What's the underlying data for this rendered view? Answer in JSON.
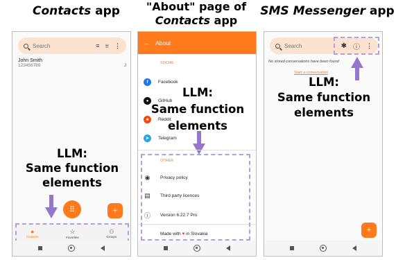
{
  "captions": {
    "left_app": "Contacts",
    "left_suffix": " app",
    "middle_line1": "\"About\" page of",
    "middle_app": "Contacts",
    "middle_suffix": " app",
    "right_app": "SMS Messenger",
    "right_suffix": " app"
  },
  "contacts": {
    "search_placeholder": "Search",
    "contact_name": "John Smith",
    "contact_number": "123456789",
    "contact_initial": "J",
    "tabs": [
      {
        "label": "Contacts",
        "icon": "person-icon"
      },
      {
        "label": "Favorites",
        "icon": "star-icon"
      },
      {
        "label": "Groups",
        "icon": "group-icon"
      }
    ],
    "fab_label": "+"
  },
  "about": {
    "title": "About",
    "social_header": "SOCIAL",
    "social_items": [
      "Facebook",
      "GitHub",
      "Reddit",
      "Telegram"
    ],
    "other_header": "OTHER",
    "other_items": [
      "Privacy policy",
      "Third party licences",
      "Version 6.22.7 Pro"
    ],
    "footer_prefix": "Made with",
    "footer_suffix": "in Slovakia"
  },
  "sms": {
    "search_placeholder": "Search",
    "empty_message": "No stored conversations have been found",
    "start_link": "Start a conversation",
    "fab_label": "+"
  },
  "annotations": {
    "llm_line1": "LLM:",
    "llm_line2": "Same function",
    "llm_line3": "elements"
  },
  "colors": {
    "accent": "#ff7a1a",
    "annotation_dash": "#b39ddb",
    "annotation_arrow": "#9575cd",
    "facebook": "#1877f2",
    "github": "#111111",
    "reddit": "#ff4500",
    "telegram": "#2aa3e0"
  }
}
